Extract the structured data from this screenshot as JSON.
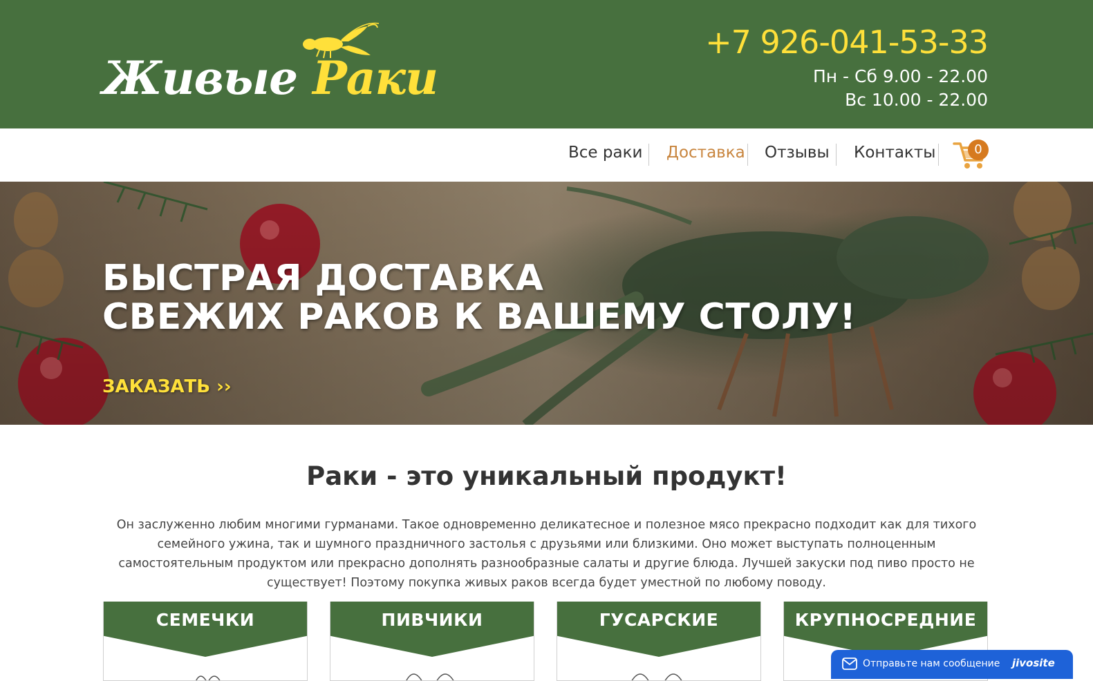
{
  "header": {
    "logo": {
      "word1": "Живые",
      "word2": "Раки"
    },
    "phone": "+7 926-041-53-33",
    "hours": [
      "Пн - Сб 9.00 - 22.00",
      "Вс 10.00 - 22.00"
    ]
  },
  "nav": {
    "items": [
      {
        "label": "Все раки",
        "active": false
      },
      {
        "label": "Доставка",
        "active": true
      },
      {
        "label": "Отзывы",
        "active": false
      },
      {
        "label": "Контакты",
        "active": false
      }
    ],
    "cart_icon": "cart-icon",
    "cart_count": "0"
  },
  "hero": {
    "title_line1": "БЫСТРАЯ ДОСТАВКА",
    "title_line2": "СВЕЖИХ РАКОВ К ВАШЕМУ СТОЛУ!",
    "order_label": "ЗАКАЗАТЬ ››"
  },
  "intro": {
    "title": "Раки - это уникальный продукт!",
    "text": "Он заслуженно любим многими гурманами. Такое одновременно деликатесное и полезное мясо прекрасно подходит как для тихого семейного ужина, так и шумного праздничного застолья с друзьями или близкими. Оно может выступать полноценным самостоятельным продуктом или прекрасно дополнять разнообразные салаты и другие блюда. Лучшей закуски под пиво просто не существует! Поэтому покупка живых раков всегда будет уместной по любому поводу."
  },
  "categories": [
    {
      "title": "СЕМЕЧКИ"
    },
    {
      "title": "ПИВЧИКИ"
    },
    {
      "title": "ГУСАРСКИЕ"
    },
    {
      "title": "КРУПНОСРЕДНИЕ"
    }
  ],
  "chat_widget": {
    "text": "Отправьте нам сообщение",
    "brand": "jivosite",
    "icon": "mail-icon"
  },
  "colors": {
    "brand_green": "#47703e",
    "accent_yellow": "#ffe03a",
    "nav_active": "#c8853e",
    "cart_badge": "#d67a1f",
    "chat_blue": "#1e62d8"
  }
}
